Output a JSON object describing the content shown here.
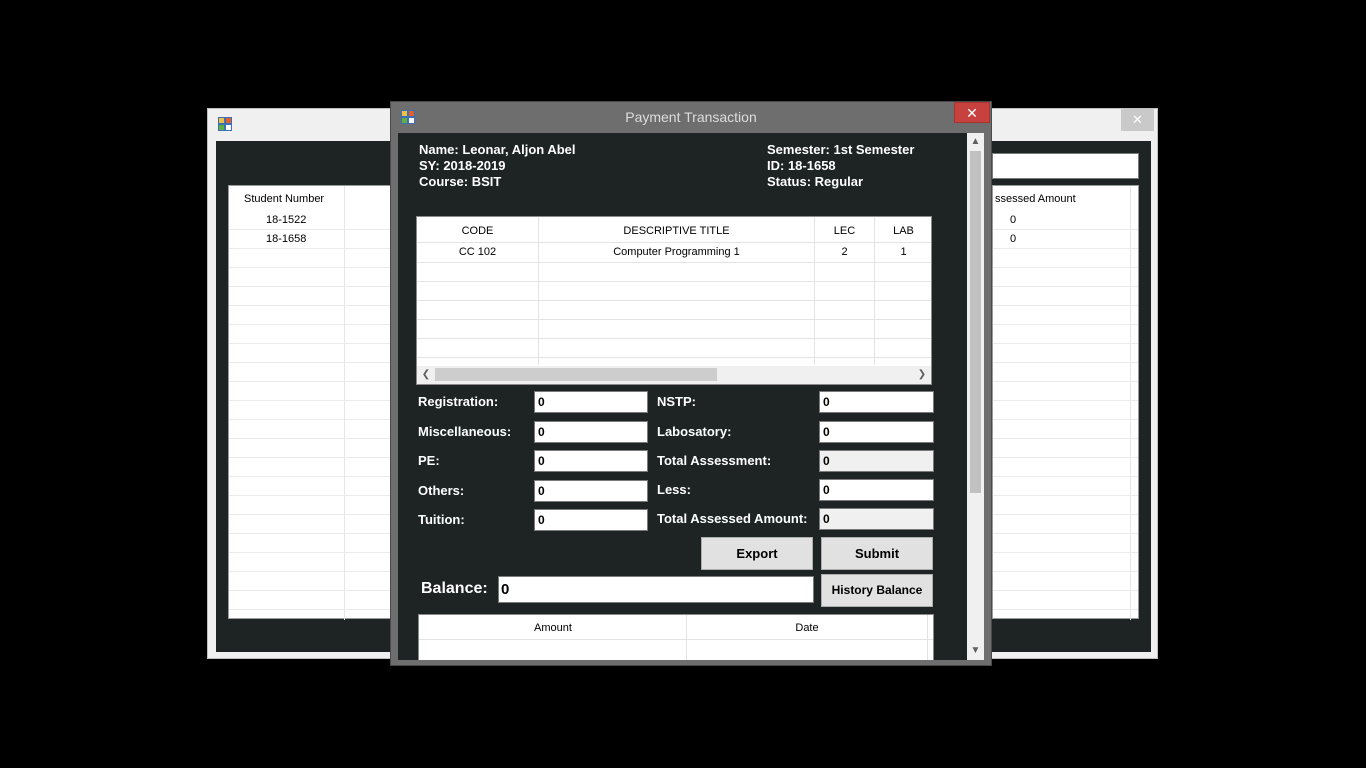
{
  "background_window": {
    "close_glyph": "✕",
    "grid": {
      "col_student_number": "Student Number",
      "col_assessed_amount": "ssessed Amount",
      "rows": [
        {
          "student_number": "18-1522",
          "assessed_amount": "0"
        },
        {
          "student_number": "18-1658",
          "assessed_amount": "0"
        }
      ]
    }
  },
  "modal": {
    "title": "Payment Transaction",
    "close_glyph": "✕",
    "info": {
      "name": "Name: Leonar, Aljon Abel",
      "sy": "SY: 2018-2019",
      "course": "Course: BSIT",
      "semester": "Semester: 1st Semester",
      "id": "ID: 18-1658",
      "status": "Status: Regular"
    },
    "subjects": {
      "headers": {
        "code": "CODE",
        "title": "DESCRIPTIVE TITLE",
        "lec": "LEC",
        "lab": "LAB"
      },
      "rows": [
        {
          "code": "CC 102",
          "title": "Computer Programming 1",
          "lec": "2",
          "lab": "1"
        }
      ]
    },
    "fees": {
      "registration_label": "Registration:",
      "registration_value": "0",
      "miscellaneous_label": "Miscellaneous:",
      "miscellaneous_value": "0",
      "pe_label": "PE:",
      "pe_value": "0",
      "others_label": "Others:",
      "others_value": "0",
      "tuition_label": "Tuition:",
      "tuition_value": "0",
      "nstp_label": "NSTP:",
      "nstp_value": "0",
      "laboratory_label": "Labosatory:",
      "laboratory_value": "0",
      "total_assessment_label": "Total Assessment:",
      "total_assessment_value": "0",
      "less_label": "Less:",
      "less_value": "0",
      "total_assessed_amount_label": "Total Assessed Amount:",
      "total_assessed_amount_value": "0"
    },
    "buttons": {
      "export": "Export",
      "submit": "Submit",
      "history_balance": "History Balance"
    },
    "balance": {
      "label": "Balance:",
      "value": "0"
    },
    "history": {
      "headers": {
        "amount": "Amount",
        "date": "Date"
      }
    }
  },
  "colors": {
    "close_button": "#c7423e",
    "panel_background": "#1e2324"
  }
}
